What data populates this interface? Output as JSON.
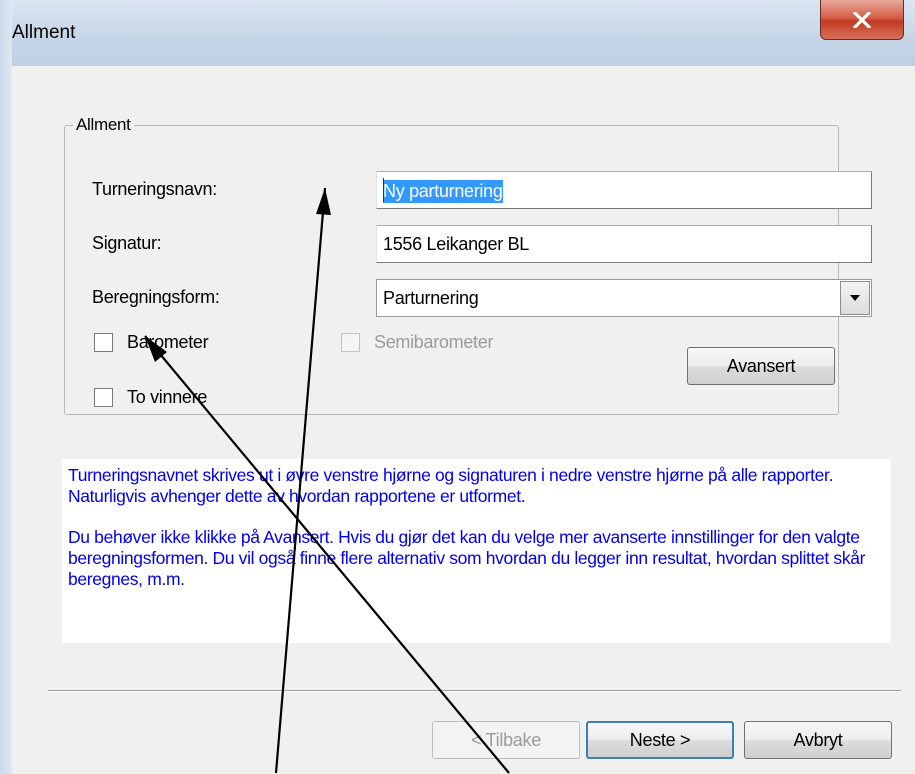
{
  "window": {
    "title": "Allment",
    "close_icon": "close-x-icon"
  },
  "group": {
    "legend": "Allment",
    "tournament_name_label": "Turneringsnavn:",
    "tournament_name_value": "Ny parturnering",
    "signature_label": "Signatur:",
    "signature_value": "1556 Leikanger BL",
    "calc_form_label": "Beregningsform:",
    "calc_form_value": "Parturnering",
    "barometer_label": "Barometer",
    "barometer_checked": false,
    "two_winners_label": "To vinnere",
    "two_winners_checked": false,
    "semibarometer_label": "Semibarometer",
    "semibarometer_enabled": false,
    "advanced_button": "Avansert"
  },
  "info": {
    "paragraph1": "Turneringsnavnet skrives ut i øvre venstre hjørne og signaturen i nedre venstre hjørne på alle rapporter. Naturligvis avhenger dette av hvordan rapportene er utformet.",
    "paragraph2": "Du behøver ikke klikke på Avansert. Hvis du gjør det kan du velge mer avanserte innstillinger for den valgte beregningsformen. Du vil også finne flere alternativ som hvordan du legger inn resultat, hvordan splittet skår beregnes, m.m."
  },
  "footer": {
    "back_button": "< Tilbake",
    "next_button": "Neste >",
    "cancel_button": "Avbryt"
  },
  "colors": {
    "info_text": "#0000ee",
    "selection": "#3399ff",
    "close_button": "#c8432b"
  }
}
